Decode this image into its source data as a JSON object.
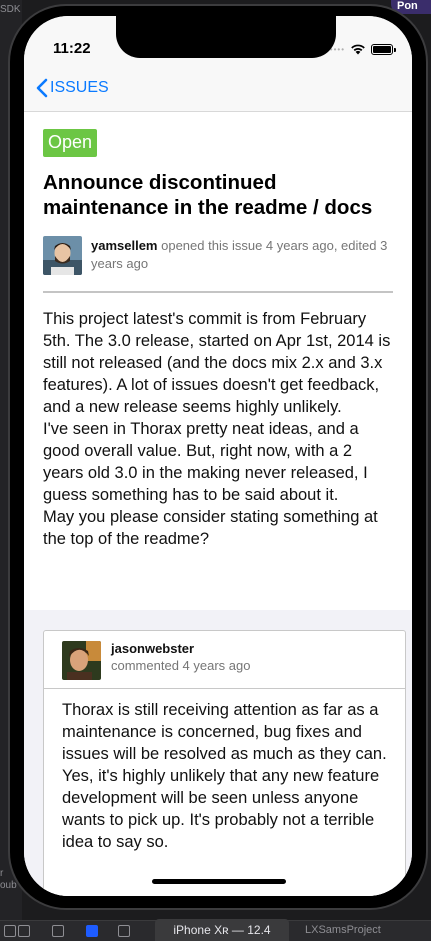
{
  "background": {
    "left_label": "SDK",
    "corner_label": "Pon",
    "bottom_left_label": "r\noub",
    "device_tab": "iPhone Xʀ — 12.4",
    "project_label": "LXSamsProject"
  },
  "status_bar": {
    "time": "11:22"
  },
  "nav": {
    "back_label": "ISSUES"
  },
  "issue": {
    "state": "Open",
    "state_color": "#6cc644",
    "title": "Announce discontinued maintenance in the readme / docs",
    "author": "yamsellem",
    "meta": " opened this issue 4 years ago, edited 3 years ago",
    "body": "This project latest's commit is from February 5th. The 3.0 release, started on Apr 1st, 2014 is still not released (and the docs mix 2.x and 3.x features). A lot of issues doesn't get feedback, and a new release seems highly unlikely.\nI've seen in Thorax pretty neat ideas, and a good overall value. But, right now, with a 2 years old 3.0 in the making never released, I guess something has to be said about it.\nMay you please consider stating something at the top of the readme?"
  },
  "comment": {
    "author": "jasonwebster",
    "time": "commented 4 years ago",
    "body": "Thorax is still receiving attention as far as a maintenance is concerned, bug fixes and issues will be resolved as much as they can. Yes, it's highly unlikely that any new feature development will be seen unless anyone wants to pick up. It's probably not a terrible idea to say so."
  },
  "colors": {
    "accent": "#0a7aff",
    "open_badge": "#6cc644"
  }
}
